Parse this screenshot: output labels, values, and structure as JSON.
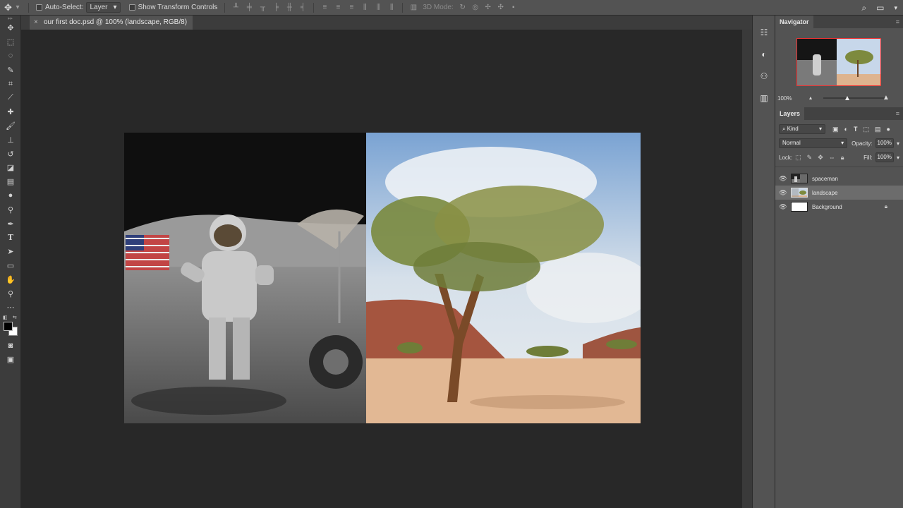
{
  "options_bar": {
    "auto_select_label": "Auto-Select:",
    "auto_select_value": "Layer",
    "show_transform_label": "Show Transform Controls",
    "mode_3d_label": "3D Mode:"
  },
  "document_tab": {
    "title": "our first doc.psd @ 100% (landscape, RGB/8)",
    "close_glyph": "×"
  },
  "navigator": {
    "tab_label": "Navigator",
    "zoom": "100%"
  },
  "layers_panel": {
    "tab_label": "Layers",
    "kind_label": "Kind",
    "blend_mode": "Normal",
    "opacity_label": "Opacity:",
    "opacity_value": "100%",
    "lock_label": "Lock:",
    "fill_label": "Fill:",
    "fill_value": "100%",
    "layers": [
      {
        "name": "spaceman",
        "selected": false
      },
      {
        "name": "landscape",
        "selected": true
      },
      {
        "name": "Background",
        "selected": false,
        "locked": true
      }
    ]
  },
  "colors": {
    "ui_dark": "#282828",
    "panel": "#535353",
    "toolbar": "#3c3c3c",
    "navigator_frame": "#e33333"
  }
}
